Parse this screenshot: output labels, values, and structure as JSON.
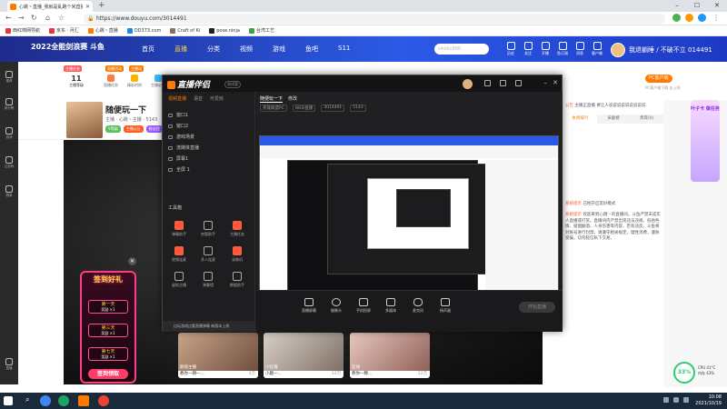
{
  "browser": {
    "tab_title": "心跳丶直播_我就是乱跑个米直播",
    "url": "https://www.douyu.com/3014491",
    "bookmarks": [
      "西红柿网导航",
      "京东 · 月汇",
      "心跳丶直播",
      "DD373.com",
      "Craft of Ki",
      "pose.ninja",
      "台湾工艺"
    ]
  },
  "site": {
    "logo": "2022全能剑浪赛 斗鱼",
    "nav": [
      "首页",
      "直播",
      "分类",
      "视频",
      "游戏",
      "鱼吧",
      "S11"
    ],
    "search_placeholder": "sikoko888",
    "header_icons": [
      "历史",
      "关注",
      "开播",
      "鱼订阅",
      "消息",
      "客户端"
    ],
    "username": "我退躺睡 / 不破不立 014491"
  },
  "sidebar": [
    "推荐",
    "排行榜",
    "游戏",
    "云游戏",
    "赛事",
    "直播"
  ],
  "room": {
    "level": "11",
    "level_label": "主播等级",
    "tags": [
      "主播任务",
      "直播活动",
      "主播动"
    ],
    "tools": [
      "直播任务",
      "精彩时刻",
      "主播必备"
    ],
    "pc_badge": "PC客户端",
    "pc_download": "PC客户端下载 去上线",
    "title": "随便玩一下",
    "sub": "主播 · 心跳丶主播 · 5143",
    "stags": [
      "V等级",
      "主播认证",
      "粉丝团"
    ]
  },
  "gift_panel": {
    "title": "签到好礼",
    "days": [
      {
        "day": "第一天",
        "reward": "奖励 ×1"
      },
      {
        "day": "第三天",
        "reward": "奖励 ×1"
      },
      {
        "day": "第七天",
        "reward": "奖励 ×1"
      }
    ],
    "button": "签到领取"
  },
  "right_panel": {
    "tabs": [
      "本周排行",
      "贡献榜",
      "贵宾(0)",
      "贵宾(0)"
    ],
    "messages": [
      {
        "tag": "公告",
        "text": "主播正直播 要让人说说说说说说说说说"
      },
      {
        "tag": "系统提示",
        "text": "已经开启友好模式"
      },
      {
        "tag": "系统提示",
        "text": "欢迎来到心跳丶的直播间，斗鱼严禁未成年人直播或打赏。直播间内严禁出现违法违规、低俗色情、吸烟酗酒、人身伤害等内容，若有违反，斗鱼将对账号进行封禁。请遵守相关规定，理性消费，谨防受骗，切勿轻信私下交易。"
      }
    ],
    "promo": "叶子卡 做任务",
    "speed_value": "33%",
    "speed_info": [
      "CPU 41°C",
      "内存 43%"
    ]
  },
  "thumbs": [
    {
      "caption": "颜值主播",
      "title": "教你一朝一...",
      "views": "4万"
    },
    {
      "caption": "小红帽",
      "title": "小趣一...",
      "views": "33万"
    },
    {
      "caption": "在线",
      "title": "教你一颗...",
      "views": "22万"
    }
  ],
  "companion": {
    "logo": "直播伴侣",
    "version": "测试版",
    "left_tabs": [
      "视频直播",
      "语音",
      "可爱房"
    ],
    "scenes": [
      "窗口1",
      "窗口2",
      "游戏场景",
      "流媒体直播",
      "屏幕1",
      "全屏 1"
    ],
    "tool_header": "工具箱",
    "tools": [
      "弹幕助手",
      "房管助手",
      "主播任务",
      "视频连麦",
      "多人连麦",
      "录像机",
      "虚拟主播",
      "弹幕墙",
      "数据助手"
    ],
    "notice": "边玩游戏边看直播弹幕 新版本上线",
    "main_tabs": [
      "随便玩一下",
      "修改"
    ],
    "main_sub": [
      "英雄联盟PC",
      "WEB直播",
      "3014491",
      "5143"
    ],
    "bottom": [
      "直播屏幕",
      "摄像头",
      "手机投屏",
      "多媒体",
      "麦克风",
      "扬声器"
    ],
    "golive": "开始直播"
  },
  "taskbar": {
    "time": "10:08",
    "date": "2021/10/19"
  }
}
